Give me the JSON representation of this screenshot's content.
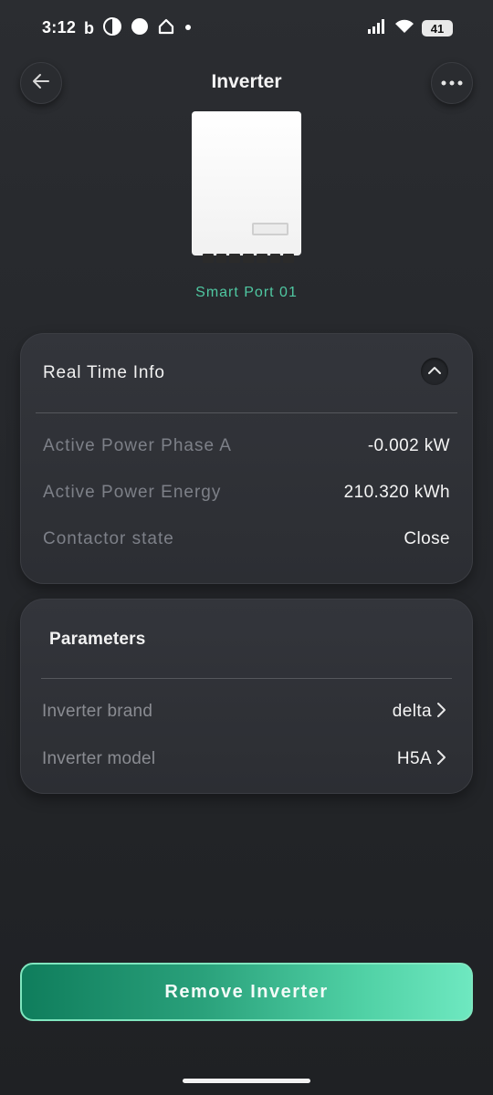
{
  "status_bar": {
    "time": "3:12",
    "battery": "41",
    "left_icons": [
      "b-app-icon",
      "half-circle-icon",
      "circle-icon",
      "home-icon",
      "dot-icon"
    ],
    "right_icons": [
      "signal-icon",
      "wifi-icon",
      "battery-icon"
    ]
  },
  "header": {
    "title": "Inverter",
    "back_icon": "arrow-left-icon",
    "more_icon": "ellipsis-icon"
  },
  "device": {
    "name": "Smart Port 01"
  },
  "real_time_info": {
    "title": "Real Time Info",
    "rows": [
      {
        "label": "Active Power Phase A",
        "value": "-0.002 kW"
      },
      {
        "label": "Active Power Energy",
        "value": "210.320 kWh"
      },
      {
        "label": "Contactor state",
        "value": "Close"
      }
    ]
  },
  "parameters": {
    "title": "Parameters",
    "rows": [
      {
        "label": "Inverter brand",
        "value": "delta"
      },
      {
        "label": "Inverter model",
        "value": "H5A"
      }
    ]
  },
  "actions": {
    "remove_label": "Remove Inverter"
  },
  "colors": {
    "accent": "#4fc7a1",
    "background": "#1f2124",
    "card": "#2f3136"
  }
}
